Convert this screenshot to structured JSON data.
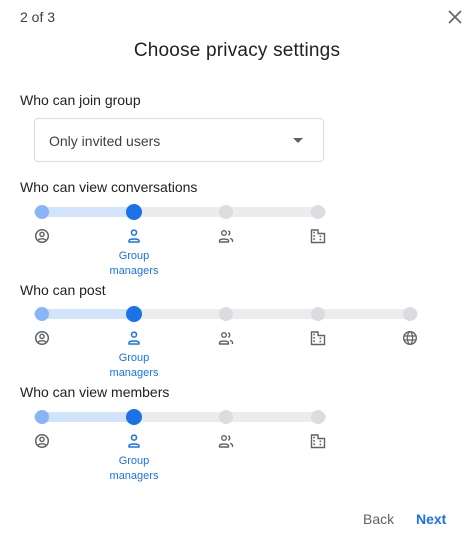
{
  "header": {
    "step": "2 of 3",
    "title": "Choose privacy settings"
  },
  "join": {
    "label": "Who can join group",
    "selected": "Only invited users"
  },
  "sections": [
    {
      "label": "Who can view conversations",
      "options": [
        "person-circle-icon",
        "person-icon",
        "people-icon",
        "building-icon"
      ],
      "selected": 1,
      "selected_label": "Group managers"
    },
    {
      "label": "Who can post",
      "options": [
        "person-circle-icon",
        "person-icon",
        "people-icon",
        "building-icon",
        "globe-icon"
      ],
      "selected": 1,
      "selected_label": "Group managers"
    },
    {
      "label": "Who can view members",
      "options": [
        "person-circle-icon",
        "person-icon",
        "people-icon",
        "building-icon"
      ],
      "selected": 1,
      "selected_label": "Group managers"
    }
  ],
  "footer": {
    "back": "Back",
    "next": "Next"
  },
  "colors": {
    "accent": "#1a73e8",
    "track_fill": "#d2e3fc",
    "inactive_dot": "#dadce0"
  }
}
